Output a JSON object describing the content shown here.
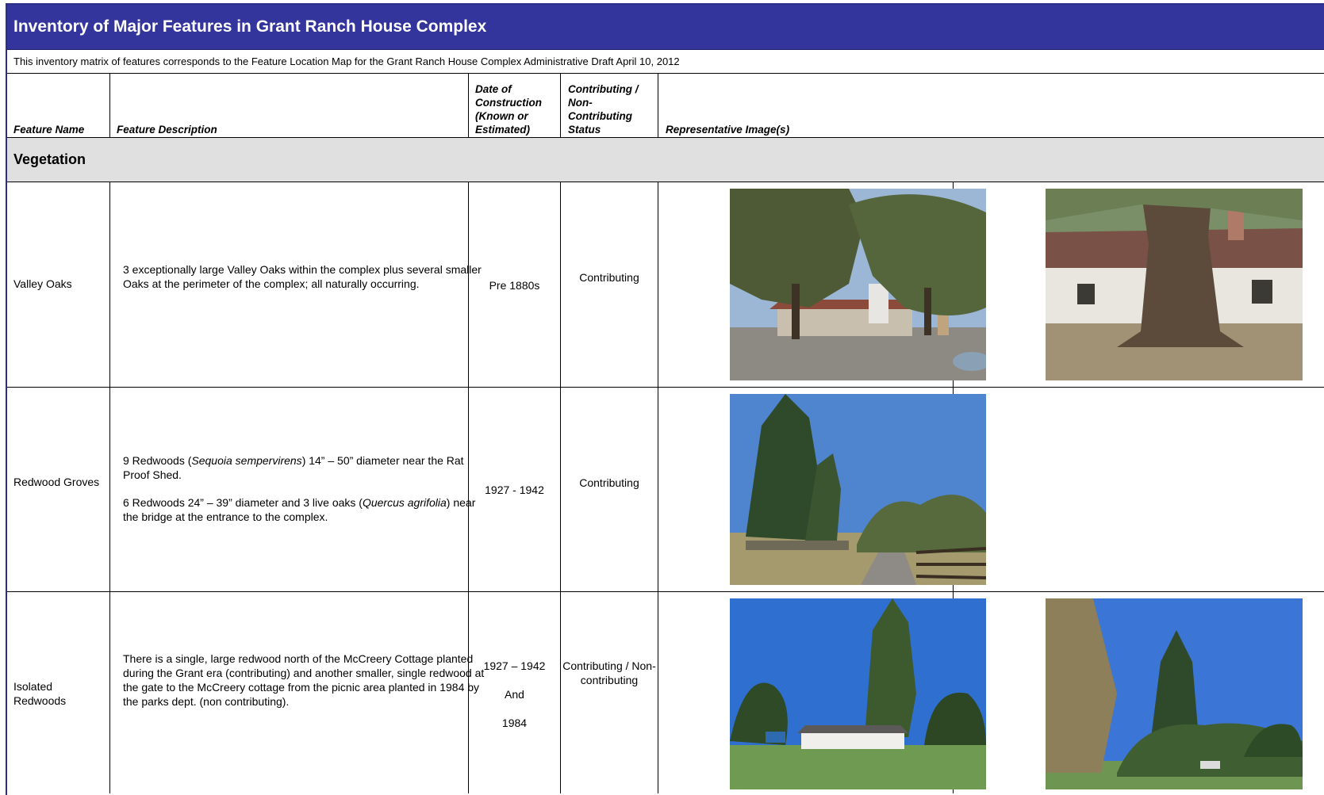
{
  "title": "Inventory of Major Features in Grant Ranch House Complex",
  "subtitle": "This inventory matrix of features corresponds to the Feature Location Map for the Grant Ranch House Complex Administrative Draft April 10, 2012",
  "columns": {
    "feature_name": "Feature Name",
    "feature_description": "Feature Description",
    "date": [
      "Date of",
      "Construction",
      "(Known or",
      "Estimated)"
    ],
    "status": [
      "Contributing /",
      "Non-",
      "Contributing",
      "Status"
    ],
    "images": "Representative Image(s)"
  },
  "section": "Vegetation",
  "rows": [
    {
      "name": "Valley Oaks",
      "description": "3 exceptionally large Valley Oaks within the complex plus several smaller Oaks at the perimeter of the complex; all naturally occurring.",
      "date": "Pre 1880s",
      "status": "Contributing"
    },
    {
      "name": "Redwood Groves",
      "desc1_pre": "9 Redwoods (",
      "desc1_italic": "Sequoia sempervirens",
      "desc1_post": ") 14” – 50” diameter near the Rat Proof Shed.",
      "desc2_pre": "6 Redwoods 24” – 39” diameter and 3 live oaks (",
      "desc2_italic": "Quercus agrifolia",
      "desc2_post": ") near the bridge at the entrance to the complex.",
      "date": "1927 - 1942",
      "status": "Contributing"
    },
    {
      "name": "Isolated Redwoods",
      "description": "There is a single, large redwood north of the McCreery Cottage planted during the Grant era (contributing) and another smaller, single redwood at the gate to the McCreery cottage from the picnic area planted in 1984 by the parks dept. (non contributing).",
      "date_lines": [
        "1927 – 1942",
        "And",
        "1984"
      ],
      "status": "Contributing / Non-contributing"
    }
  ],
  "colors": {
    "title_bar": "#33349c",
    "section_bg": "#e0e0e0",
    "border": "#000000"
  }
}
